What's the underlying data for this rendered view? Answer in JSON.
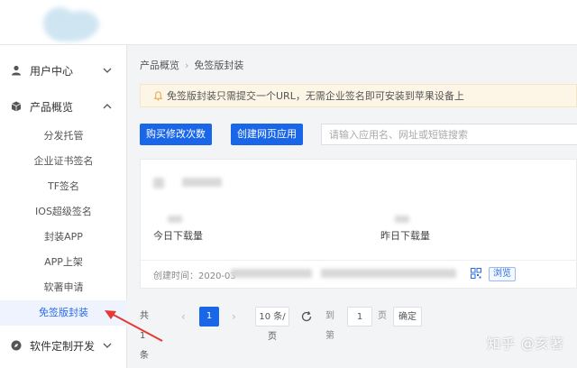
{
  "sidebar": {
    "groups": [
      {
        "label": "用户中心",
        "icon": "user-icon",
        "chevron": "down"
      },
      {
        "label": "产品概览",
        "icon": "cube-icon",
        "chevron": "up"
      },
      {
        "label": "软件定制开发",
        "icon": "compass-icon",
        "chevron": "down"
      }
    ],
    "items": [
      "分发托管",
      "企业证书签名",
      "TF签名",
      "IOS超级签名",
      "封装APP",
      "APP上架",
      "软著申请",
      "免签版封装"
    ],
    "active_item": "免签版封装"
  },
  "breadcrumb": {
    "parent": "产品概览",
    "separator": "›",
    "current": "免签版封装"
  },
  "notice": {
    "text": "免签版封装只需提交一个URL，无需企业签名即可安装到苹果设备上"
  },
  "toolbar": {
    "buy_label": "购买修改次数",
    "create_label": "创建网页应用",
    "search_placeholder": "请输入应用名、网址或短链搜索"
  },
  "card": {
    "today_label": "今日下载量",
    "yesterday_label": "昨日下载量",
    "created_prefix": "创建时间：2020-03",
    "browse_label": "浏览"
  },
  "pagination": {
    "total": "共 1 条",
    "current_page": "1",
    "page_size": "10 条/页",
    "goto_prefix": "到第",
    "goto_value": "1",
    "goto_suffix": "页",
    "confirm_label": "确定"
  },
  "watermark": "知乎 @亥著",
  "colors": {
    "primary": "#1a66e8",
    "active_bg": "#eef3fd",
    "notice_bg": "#fdf6e7",
    "arrow": "#e53935"
  }
}
